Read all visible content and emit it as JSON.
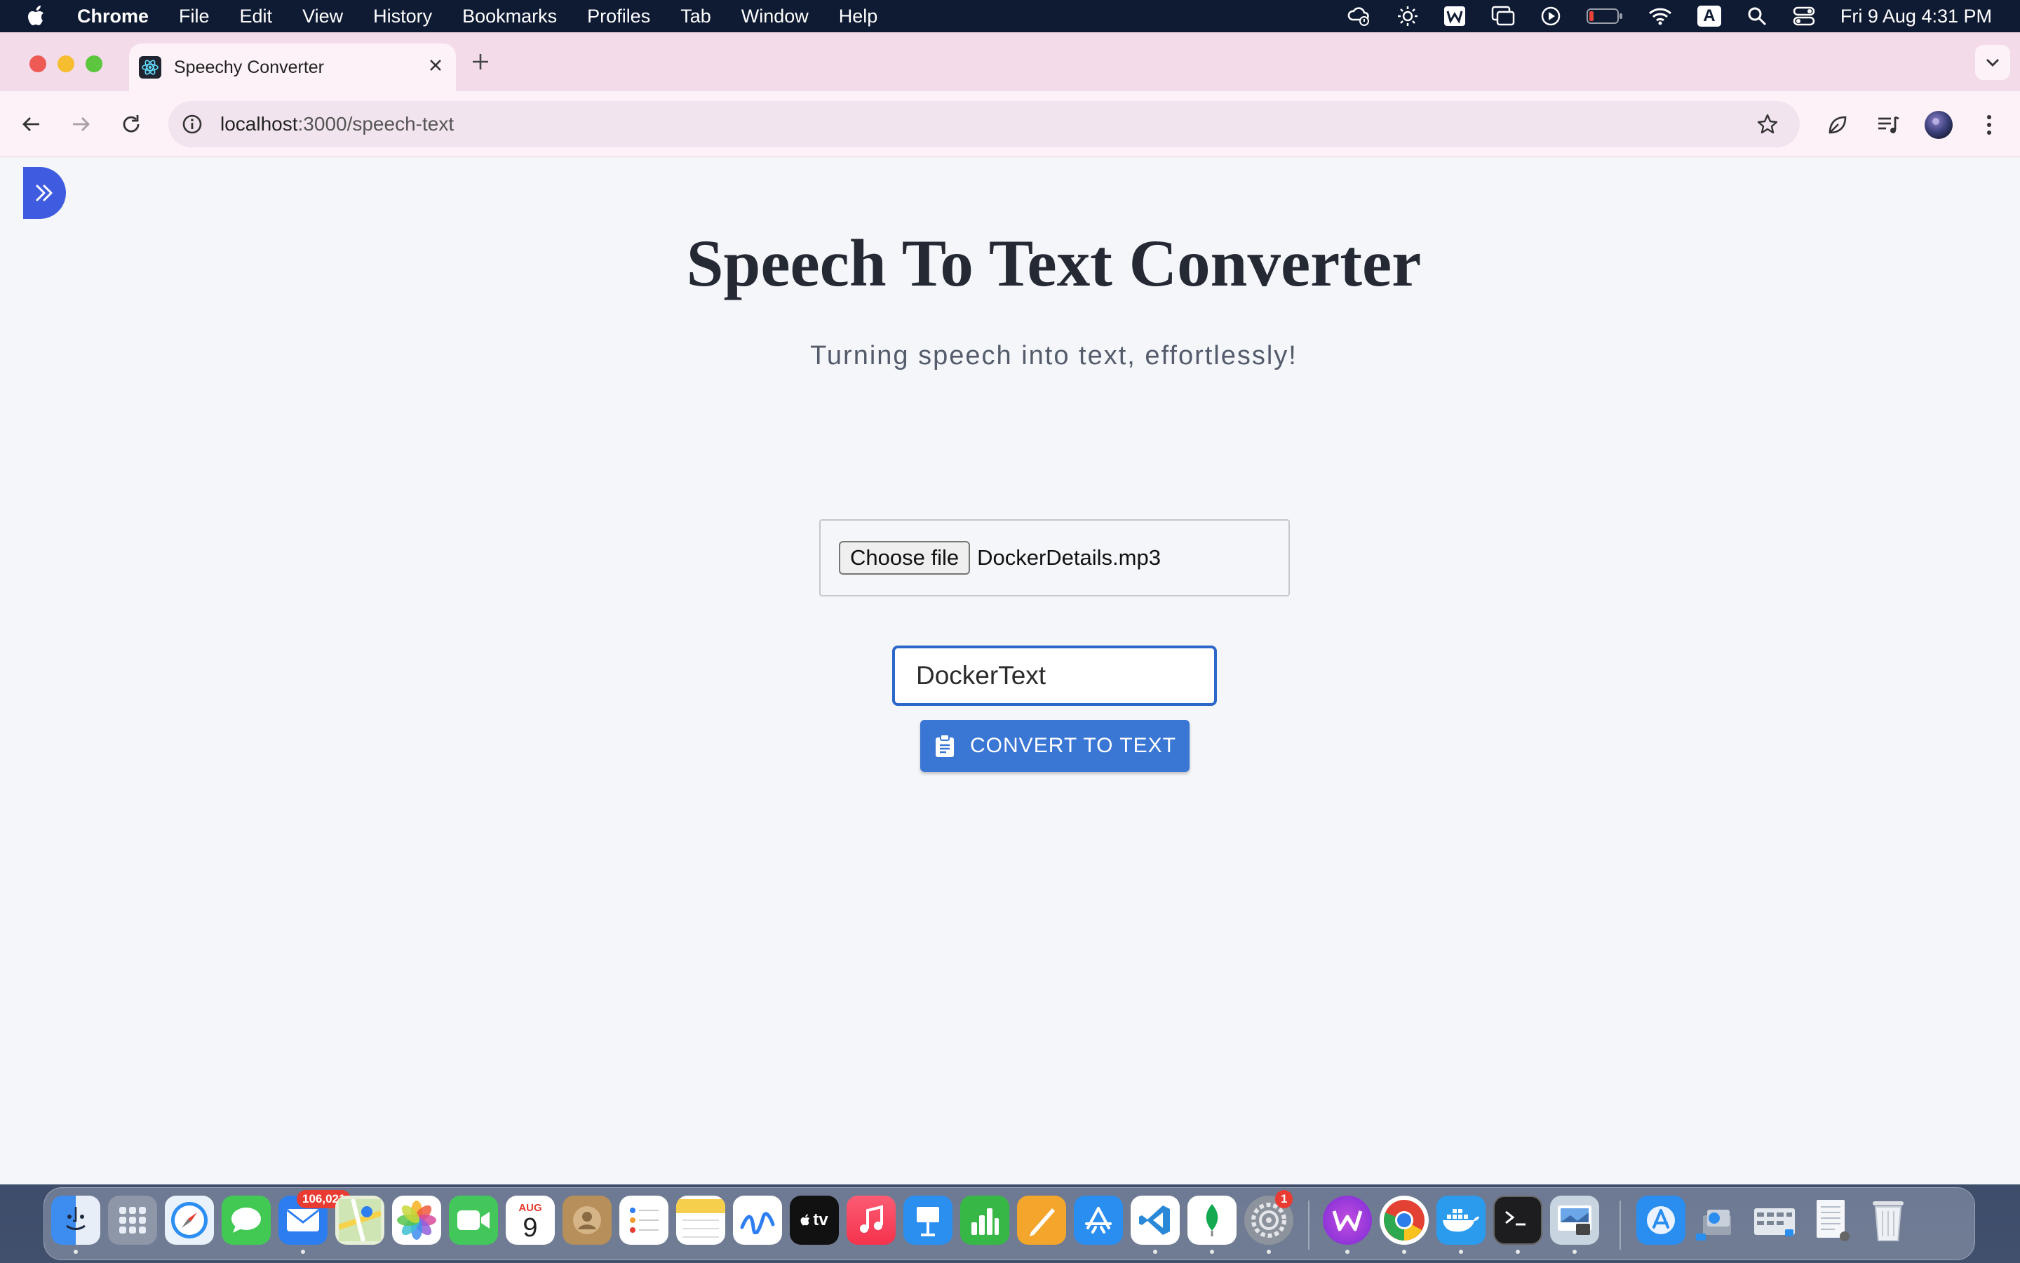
{
  "menubar": {
    "app": "Chrome",
    "menus": [
      "File",
      "Edit",
      "View",
      "History",
      "Bookmarks",
      "Profiles",
      "Tab",
      "Window",
      "Help"
    ],
    "input_source": "A",
    "clock": "Fri 9 Aug  4:31 PM"
  },
  "browser": {
    "tab_title": "Speechy Converter",
    "url_host": "localhost",
    "url_path": ":3000/speech-text"
  },
  "page": {
    "title": "Speech To Text Converter",
    "subtitle": "Turning speech into text, effortlessly!",
    "file_button": "Choose file",
    "file_name": "DockerDetails.mp3",
    "text_input_value": "DockerText",
    "convert_label": "CONVERT TO TEXT"
  },
  "dock": {
    "calendar_month": "AUG",
    "calendar_day": "9",
    "mail_badge": "106,021",
    "settings_badge": "1",
    "appletv_label": "tv"
  },
  "colors": {
    "accent": "#3a76d4",
    "sidebar_toggle": "#3f5be0",
    "tabstrip": "#f3dbe9",
    "page_bg": "#f4f6fa"
  }
}
